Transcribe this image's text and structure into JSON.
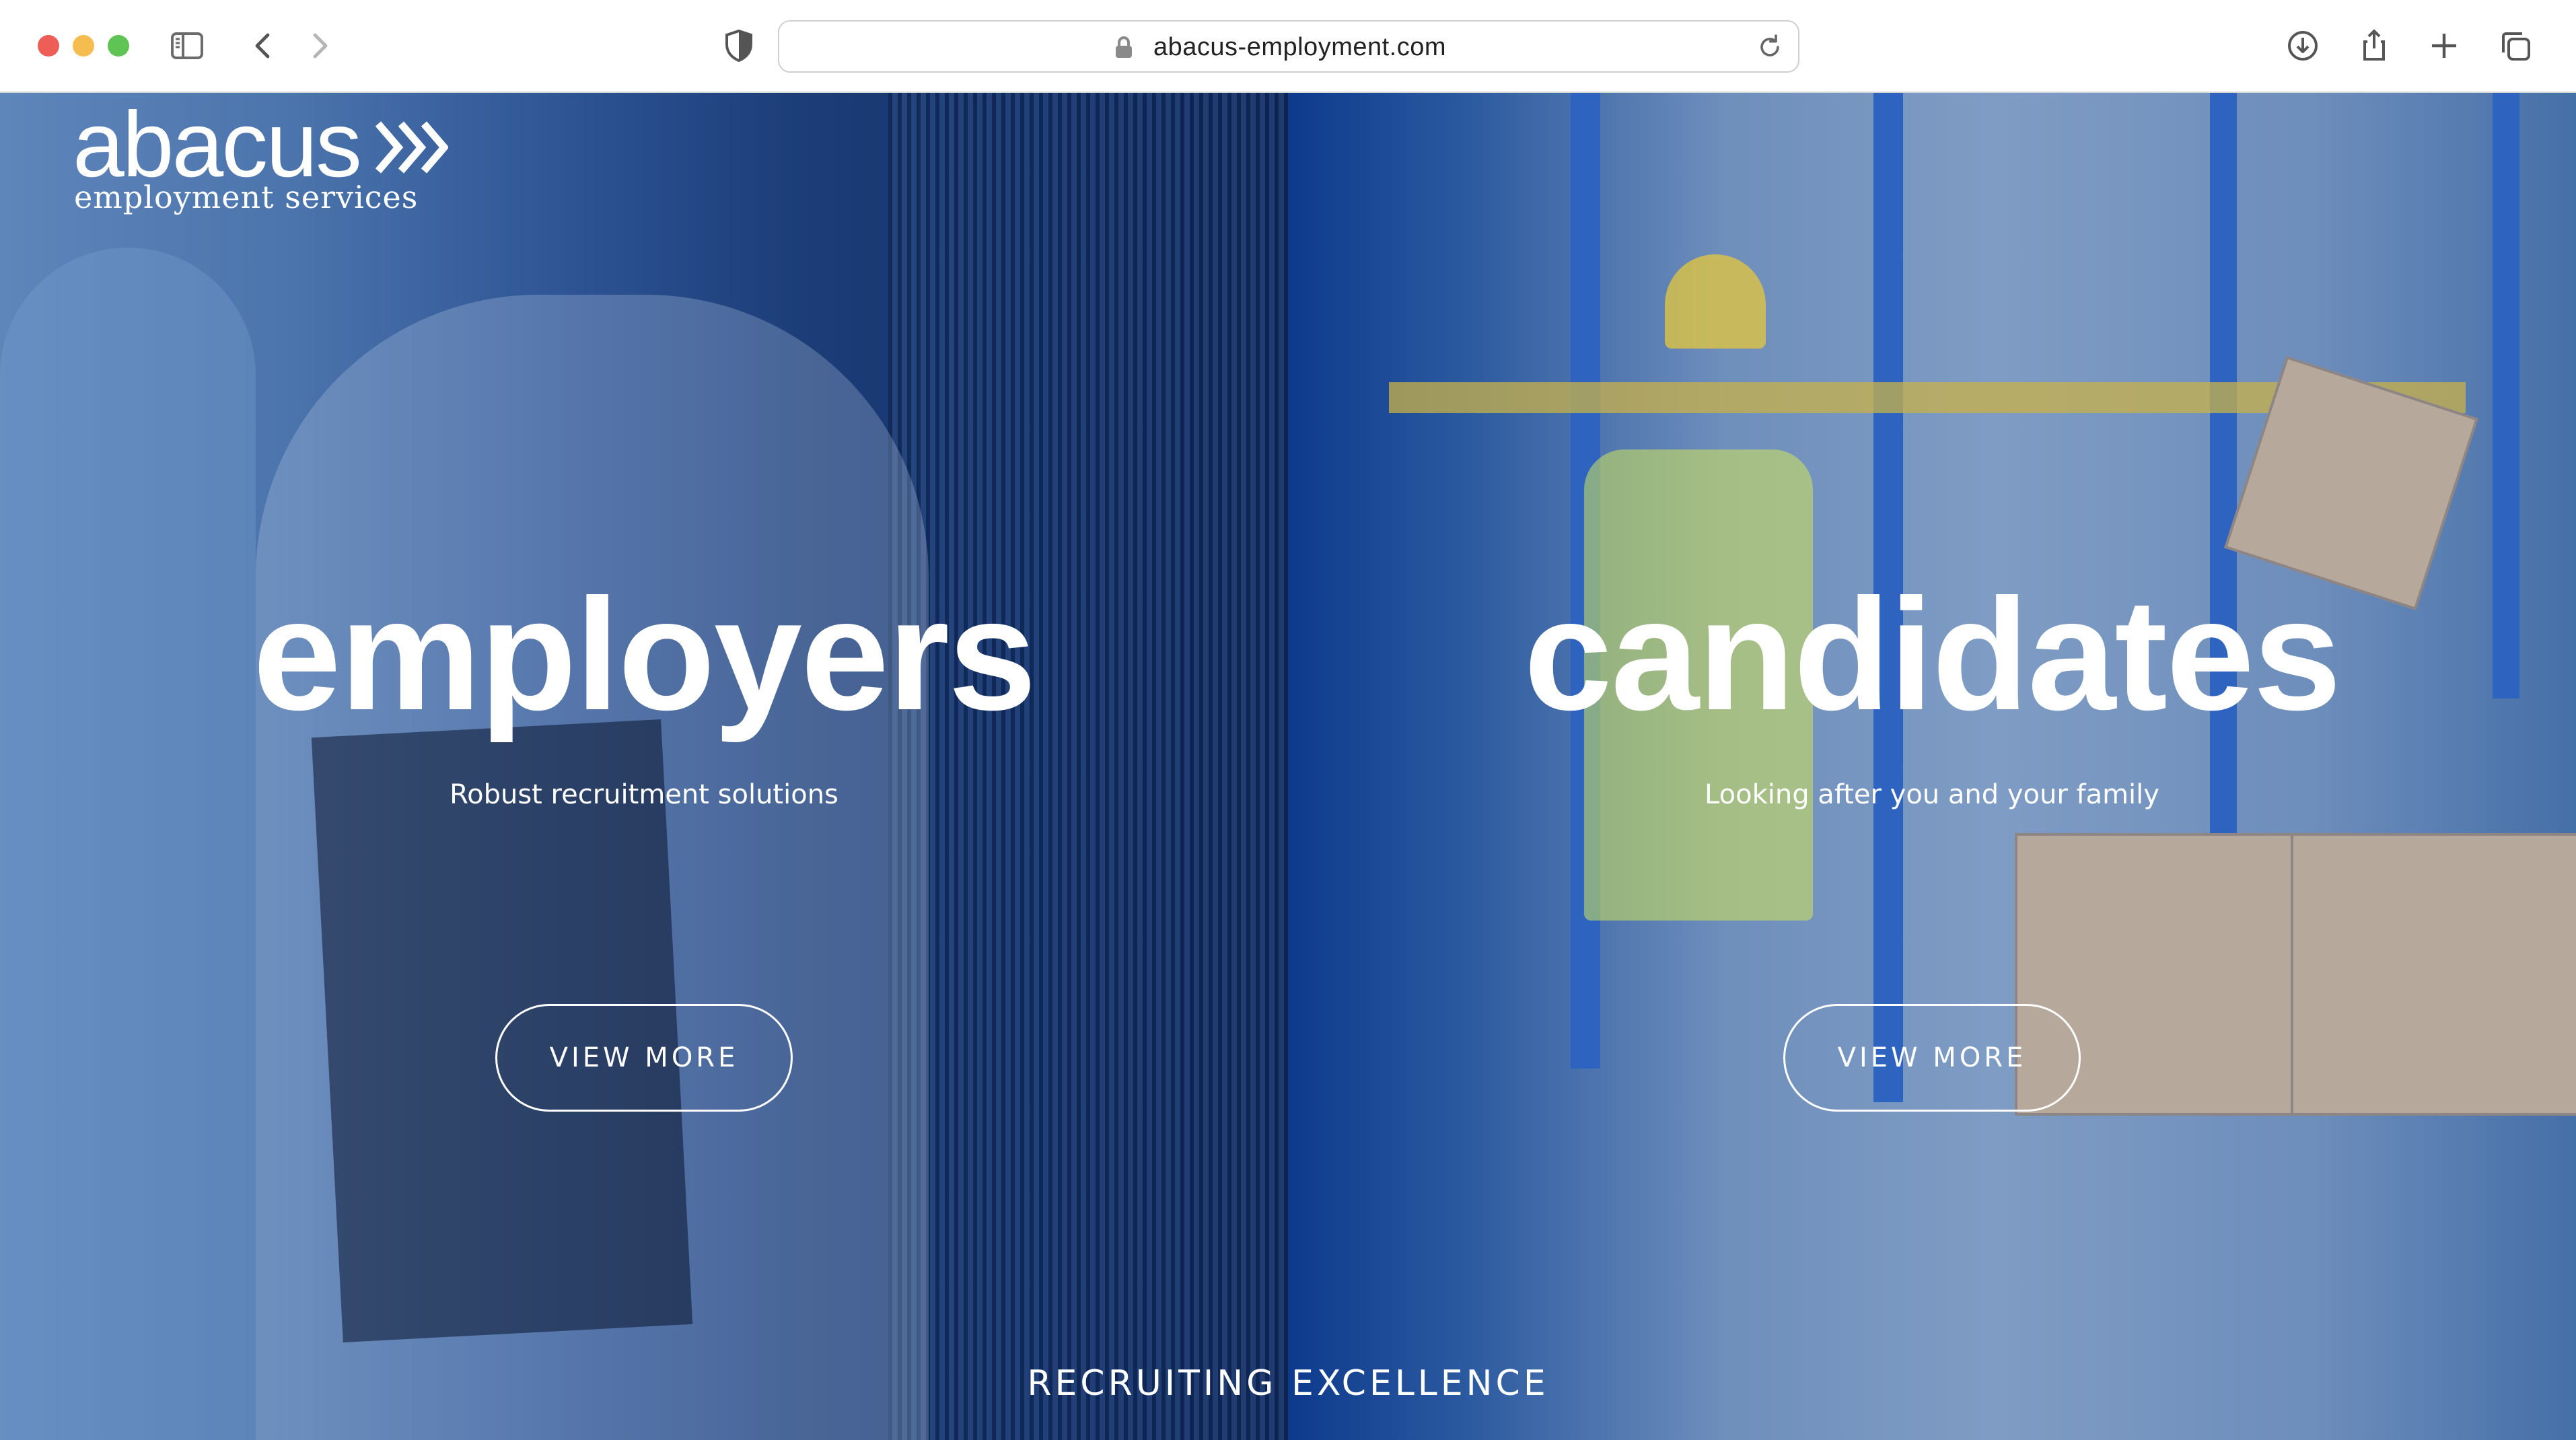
{
  "browser": {
    "url": "abacus-employment.com",
    "icons": [
      "sidebar-icon",
      "back-icon",
      "forward-icon",
      "privacy-shield-icon",
      "lock-icon",
      "reload-icon",
      "download-icon",
      "share-icon",
      "new-tab-icon",
      "tab-overview-icon"
    ]
  },
  "logo": {
    "word": "abacus",
    "tagline": "employment services"
  },
  "panels": [
    {
      "title": "employers",
      "subtitle": "Robust recruitment solutions",
      "button": "VIEW MORE"
    },
    {
      "title": "candidates",
      "subtitle": "Looking after you and your family",
      "button": "VIEW MORE"
    }
  ],
  "footer": {
    "tagline": "RECRUITING EXCELLENCE"
  },
  "colors": {
    "overlay_blue": "#1c3d78",
    "text": "#ffffff",
    "traffic_red": "#ee5e57",
    "traffic_yellow": "#f5bd4f",
    "traffic_green": "#5fc454"
  }
}
